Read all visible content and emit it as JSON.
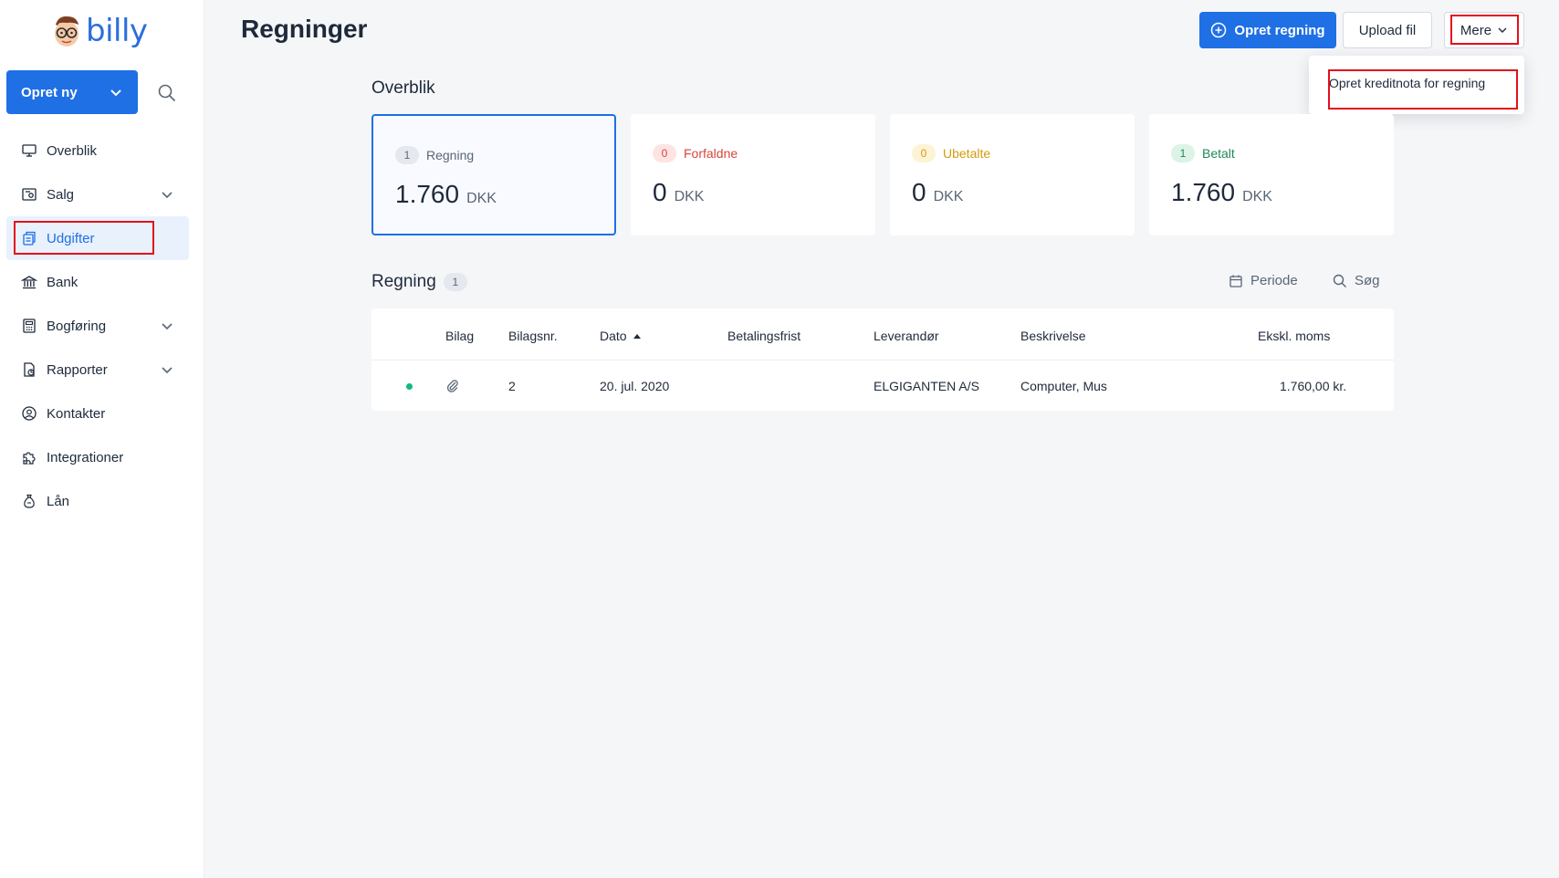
{
  "app": {
    "logo_text": "billy"
  },
  "sidebar": {
    "create_label": "Opret ny",
    "items": [
      {
        "label": "Overblik",
        "icon": "monitor-icon"
      },
      {
        "label": "Salg",
        "icon": "sales-icon",
        "has_submenu": true
      },
      {
        "label": "Udgifter",
        "icon": "expenses-icon",
        "active": true
      },
      {
        "label": "Bank",
        "icon": "bank-icon"
      },
      {
        "label": "Bogføring",
        "icon": "calculator-icon",
        "has_submenu": true
      },
      {
        "label": "Rapporter",
        "icon": "reports-icon",
        "has_submenu": true
      },
      {
        "label": "Kontakter",
        "icon": "contacts-icon"
      },
      {
        "label": "Integrationer",
        "icon": "puzzle-icon"
      },
      {
        "label": "Lån",
        "icon": "money-bag-icon"
      }
    ]
  },
  "header": {
    "title": "Regninger",
    "create_bill_label": "Opret regning",
    "upload_label": "Upload fil",
    "more_label": "Mere"
  },
  "dropdown": {
    "items": [
      "Opret kreditnota for regning"
    ]
  },
  "overview": {
    "title": "Overblik",
    "cards": [
      {
        "count": "1",
        "label": "Regning",
        "value": "1.760",
        "currency": "DKK",
        "color": "#5a6676",
        "pill_bg": "#e5e8ee"
      },
      {
        "count": "0",
        "label": "Forfaldne",
        "value": "0",
        "currency": "DKK",
        "color": "#d9453b",
        "pill_bg": "#fde4e2"
      },
      {
        "count": "0",
        "label": "Ubetalte",
        "value": "0",
        "currency": "DKK",
        "color": "#d49b0b",
        "pill_bg": "#fdf3d5"
      },
      {
        "count": "1",
        "label": "Betalt",
        "value": "1.760",
        "currency": "DKK",
        "color": "#1d8a55",
        "pill_bg": "#dcf3e6"
      }
    ]
  },
  "list": {
    "title": "Regning",
    "count": "1",
    "period_label": "Periode",
    "search_label": "Søg",
    "columns": [
      "Bilag",
      "Bilagsnr.",
      "Dato",
      "Betalingsfrist",
      "Leverandør",
      "Beskrivelse",
      "Ekskl. moms"
    ],
    "rows": [
      {
        "status_color": "#12b886",
        "attachment_icon": "paperclip-icon",
        "voucher_no": "2",
        "date": "20. jul. 2020",
        "due": "",
        "supplier": "ELGIGANTEN A/S",
        "description": "Computer, Mus",
        "amount": "1.760,00 kr."
      }
    ]
  }
}
